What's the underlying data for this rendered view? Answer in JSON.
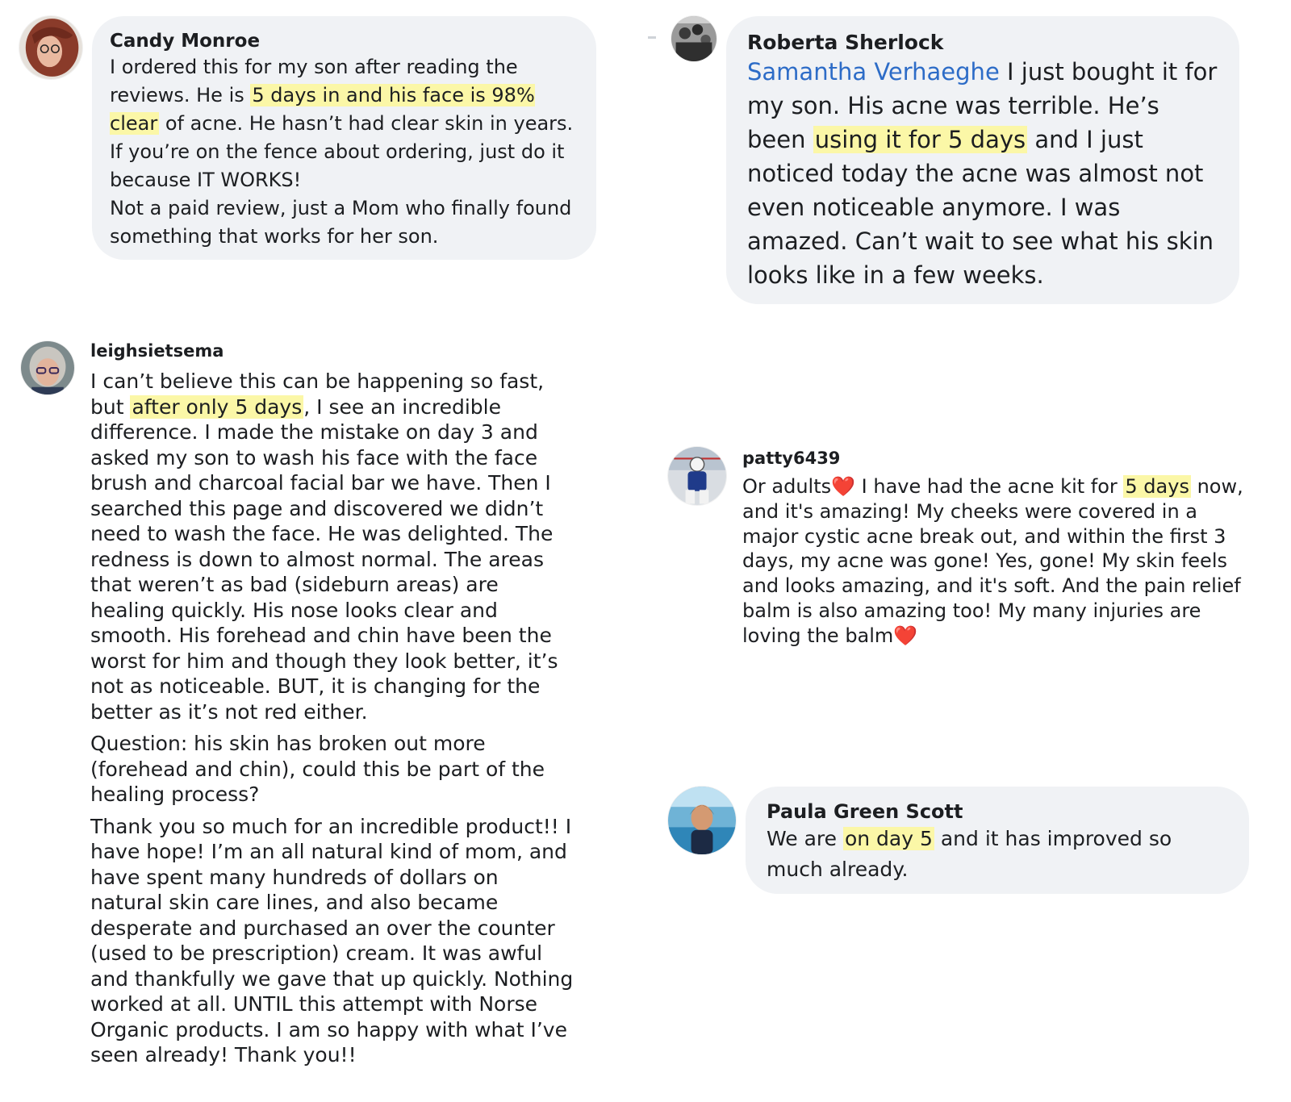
{
  "reviews": [
    {
      "author": "Candy Monroe",
      "avatar_icon": "woman-red-hair-glasses-avatar",
      "paragraphs": [
        [
          {
            "t": "I ordered this for my son after reading the reviews. He is "
          },
          {
            "t": "5 days in and his face is 98% clear",
            "hl": true
          },
          {
            "t": " of acne. He hasn’t had clear skin in years."
          }
        ],
        [
          {
            "t": "If you’re on the fence about ordering, just do it because IT WORKS!"
          }
        ],
        [
          {
            "t": "Not a paid review, just a Mom who finally found something that works for her son."
          }
        ]
      ]
    },
    {
      "author": "Roberta Sherlock",
      "avatar_icon": "black-white-group-photo-avatar",
      "paragraphs": [
        [
          {
            "t": "Samantha Verhaeghe",
            "mention": true
          },
          {
            "t": " I just bought it for my son. His acne was terrible. He’s been "
          },
          {
            "t": "using it for 5 days",
            "hl": true
          },
          {
            "t": " and I just noticed today the acne was almost not even noticeable anymore. I was amazed. Can’t wait to see what his skin looks like in a few weeks."
          }
        ]
      ]
    },
    {
      "author": "leighsietsema",
      "avatar_icon": "woman-gray-hair-glasses-avatar",
      "paragraphs": [
        [
          {
            "t": "I can’t believe this can be happening so fast, but "
          },
          {
            "t": "after only 5 days",
            "hl": true
          },
          {
            "t": ", I see an incredible difference. I made the mistake on day 3 and asked my son to wash his face with the face brush and charcoal facial bar we have. Then I searched this page and discovered we didn’t need to wash the face. He was delighted. The redness is down to almost normal. The areas that weren’t as bad (sideburn areas) are healing quickly. His nose looks clear and smooth. His forehead and chin have been the worst for him and though they look better, it’s not as noticeable. BUT, it is changing for the better as it’s not red either."
          }
        ],
        [
          {
            "t": "Question: his skin has broken out more (forehead and chin), could this be part of the healing process?"
          }
        ],
        [
          {
            "t": "Thank you so much for an incredible product!! I have hope!  I’m an all natural kind of mom, and have spent many hundreds of dollars on natural skin care lines, and also became desperate and purchased an over the counter (used to be prescription) cream. It was awful and thankfully we gave that up quickly. Nothing worked at all. UNTIL this attempt with Norse Organic products. I am so happy with what I’ve seen already!  Thank you!!"
          }
        ]
      ]
    },
    {
      "author": "patty6439",
      "avatar_icon": "hockey-goalie-avatar",
      "paragraphs": [
        [
          {
            "t": "Or adults"
          },
          {
            "t": "❤️",
            "emoji": true
          },
          {
            "t": " I have had the acne kit for "
          },
          {
            "t": "5 days",
            "hl": true
          },
          {
            "t": " now, and it's amazing! My cheeks were covered in a major cystic acne break out, and within the first 3 days, my acne was gone! Yes, gone! My skin feels and looks amazing, and it's soft. And the pain relief balm is also amazing too! My many injuries are loving the balm"
          },
          {
            "t": "❤️",
            "emoji": true
          }
        ]
      ]
    },
    {
      "author": "Paula Green Scott",
      "avatar_icon": "woman-at-sea-avatar",
      "paragraphs": [
        [
          {
            "t": "We are "
          },
          {
            "t": "on day 5",
            "hl": true
          },
          {
            "t": " and it has improved so much already."
          }
        ]
      ]
    }
  ]
}
